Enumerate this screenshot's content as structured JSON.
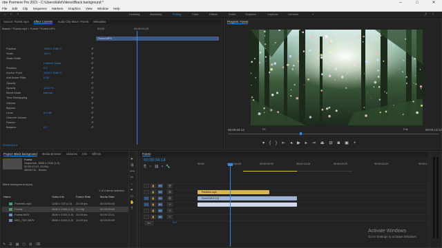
{
  "titlebar": {
    "title": "obe Premiere Pro 2021 - C:\\Users\\ilabi\\Videos\\Black background *"
  },
  "menu": [
    "File",
    "Edit",
    "Clip",
    "Sequence",
    "Markers",
    "Graphics",
    "View",
    "Window",
    "Help"
  ],
  "workspaces": [
    "Learning",
    "Assembly",
    "Editing",
    "Color",
    "Effects",
    "Audio",
    "Graphics",
    "Captions",
    "Libraries"
  ],
  "source_tabs": [
    "Source: Forest.mp4",
    "Effect Controls",
    "Audio Clip Mixer: Forest",
    "Metadata"
  ],
  "effect_controls": {
    "clip_path": "Master * Forest.mp4  >  Forest * Forest.MP4",
    "tc_start": "00:00",
    "tc_end": "00:00:04:23",
    "clip_name": "Forest.MP4",
    "rows": [
      {
        "label": "Position",
        "value": "1920.0   1080.0"
      },
      {
        "label": "Scale",
        "value": "100.0"
      },
      {
        "label": "Scale Width",
        "value": ""
      },
      {
        "label": "",
        "value": "Uniform Scale"
      },
      {
        "label": "Rotation",
        "value": "0.0"
      },
      {
        "label": "Anchor Point",
        "value": "1920.0   1080.0"
      },
      {
        "label": "Anti-flicker Filter",
        "value": "0.00"
      },
      {
        "label": "Opacity",
        "value": ""
      },
      {
        "label": "Opacity",
        "value": "100.0 %"
      },
      {
        "label": "Blend Mode",
        "value": "Normal"
      },
      {
        "label": "Time Remapping",
        "value": ""
      },
      {
        "label": "Volume",
        "value": ""
      },
      {
        "label": "Bypass",
        "value": ""
      },
      {
        "label": "Level",
        "value": "0.0 dB"
      },
      {
        "label": "Channel Volume",
        "value": ""
      },
      {
        "label": "Panner",
        "value": ""
      },
      {
        "label": "Balance",
        "value": "0.0"
      }
    ],
    "timecode": "00:00:04:14"
  },
  "program": {
    "tab": "Program: Forest",
    "timecode": "00:00:04:14",
    "fit": "Fit",
    "quality": "Full",
    "end_timecode": "00:00:13:12"
  },
  "project": {
    "tabs": [
      "Project: Black background",
      "Media Browser",
      "Libraries",
      "Info",
      "Effects"
    ],
    "clip_name": "Forest",
    "clip_info": [
      "Sequence, 3840 x 2160 (1.0)",
      "00:00:13:12, 24.00p",
      "48000 Hz - Stereo"
    ],
    "path": "Black background.prproj",
    "items_label": "1 of 4 items selected",
    "columns": [
      "Name",
      "Video Info",
      "Frame Rate",
      "Media Start"
    ],
    "items": [
      {
        "name": "Particles.mp4",
        "info": "1280 x 720 (1.0)",
        "rate": "24.00 fps",
        "start": "00:00:00:00",
        "color": "#4a9b7a"
      },
      {
        "name": "Forest",
        "info": "3840 x 2160 (1.0)",
        "rate": "24.00p",
        "start": "00:00:00:00",
        "color": "#4a9b7a"
      },
      {
        "name": "Forest.MOV",
        "info": "3840 x 2160 (1.0)",
        "rate": "24.00 fps",
        "start": "00:00:13:11",
        "color": "#6c8cc0"
      },
      {
        "name": "IMG_7321.MOV",
        "info": "3840 x 2160 (1.0)",
        "rate": "24.00 fps",
        "start": "00:00:00:00",
        "color": "#6c8cc0"
      }
    ]
  },
  "timeline": {
    "tab": "Forest",
    "timecode": "00:00:04:14",
    "ruler": [
      "00:00",
      "00:00:04:23",
      "00:00:09:23",
      "00:00:14:23",
      "00:00:19:23",
      "00:00:24:23",
      "00:00:1"
    ],
    "tracks": [
      {
        "name": "V3",
        "kind": "video"
      },
      {
        "name": "V2",
        "kind": "video"
      },
      {
        "name": "V1",
        "kind": "video"
      },
      {
        "name": "A1",
        "kind": "audio"
      },
      {
        "name": "A2",
        "kind": "audio"
      },
      {
        "name": "A3",
        "kind": "audio"
      },
      {
        "name": "Mix",
        "kind": "mix",
        "value": "0.0"
      }
    ],
    "clips": [
      {
        "label": "Particles.mp4",
        "track": "V2"
      },
      {
        "label": "Forest.MOV [V]",
        "track": "V1"
      },
      {
        "label": "",
        "track": "A1"
      }
    ]
  },
  "watermark": {
    "title": "Activate Windows",
    "subtitle": "Go to Settings to activate Windows."
  }
}
